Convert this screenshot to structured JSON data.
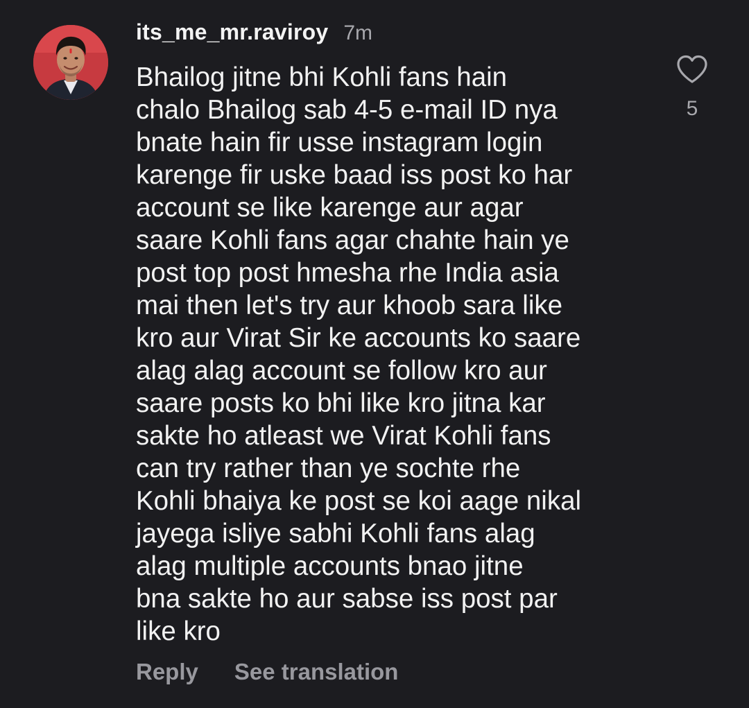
{
  "comment": {
    "username": "its_me_mr.raviroy",
    "time_ago": "7m",
    "avatar_icon": "profile-photo",
    "body_lines": [
      "Bhailog jitne bhi Kohli fans hain",
      "chalo Bhailog sab 4-5 e-mail ID nya",
      "bnate hain fir usse instagram login",
      "karenge fir uske baad iss post ko har",
      "account se like karenge aur agar",
      "saare Kohli fans agar chahte hain ye",
      "post top post hmesha rhe India asia",
      "mai then let's try aur khoob sara like",
      "kro aur Virat Sir ke accounts ko saare",
      "alag alag account se follow kro aur",
      "saare posts ko bhi like kro jitna kar",
      "sakte ho atleast we Virat Kohli fans",
      "can try rather than ye sochte rhe",
      "Kohli bhaiya ke post se koi aage nikal",
      "jayega isliye sabhi Kohli fans alag",
      "alag multiple accounts bnao jitne",
      "bna sakte ho aur sabse iss post par",
      "like kro"
    ],
    "like_icon": "heart-outline-icon",
    "like_count": "5",
    "actions": {
      "reply_label": "Reply",
      "translate_label": "See translation"
    }
  },
  "colors": {
    "background": "#1c1c20",
    "text_primary": "#f2f2f2",
    "text_secondary": "#a8a8ad",
    "action_text": "#98989e"
  }
}
